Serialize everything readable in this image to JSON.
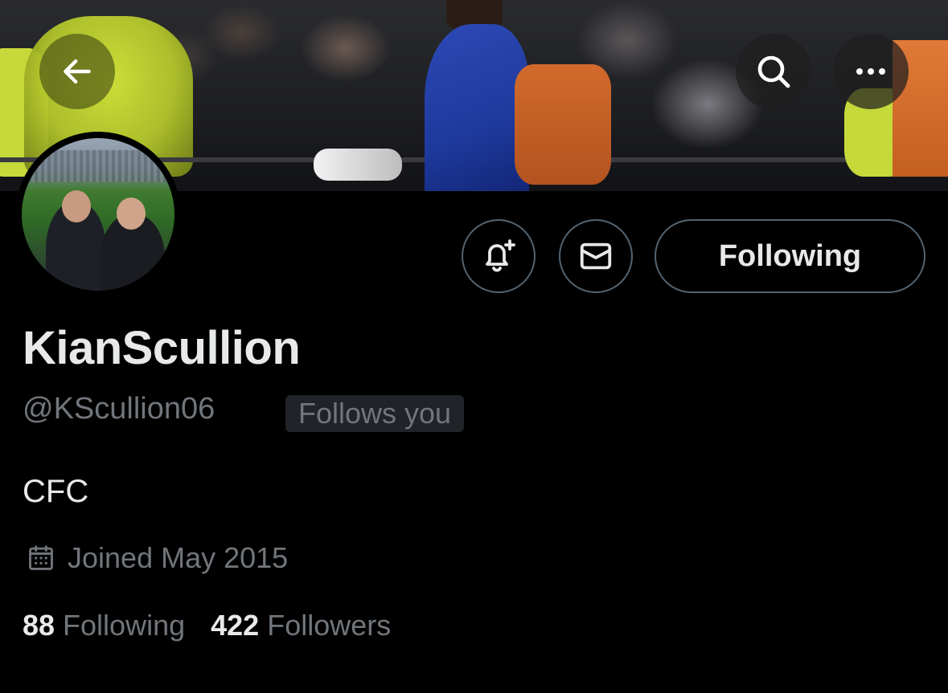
{
  "profile": {
    "display_name": "KianScullion",
    "handle": "@KScullion06",
    "follows_you_badge": "Follows you",
    "bio": "CFC",
    "joined": "Joined May 2015"
  },
  "actions": {
    "following_button_label": "Following",
    "notify_icon": "bell-plus-icon",
    "message_icon": "envelope-icon"
  },
  "header": {
    "back_icon": "arrow-left-icon",
    "search_icon": "search-icon",
    "more_icon": "more-horizontal-icon"
  },
  "stats": {
    "following_count": "88",
    "following_label": "Following",
    "followers_count": "422",
    "followers_label": "Followers"
  },
  "colors": {
    "background": "#000000",
    "primary_text": "#e7e9ea",
    "secondary_text": "#71767b",
    "border": "#536471",
    "badge_background": "#202327"
  }
}
